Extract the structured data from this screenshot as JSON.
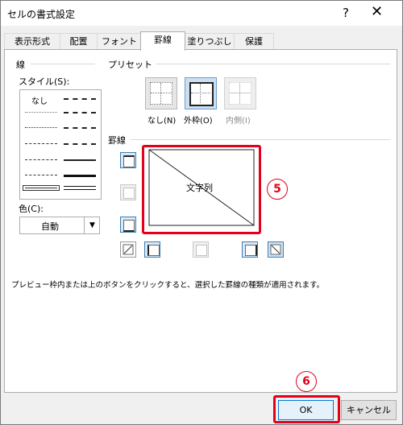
{
  "window": {
    "title": "セルの書式設定",
    "help": "?",
    "close": "✕"
  },
  "tabs": [
    {
      "label": "表示形式"
    },
    {
      "label": "配置"
    },
    {
      "label": "フォント"
    },
    {
      "label": "罫線"
    },
    {
      "label": "塗りつぶし"
    },
    {
      "label": "保護"
    }
  ],
  "line_group": {
    "heading": "線",
    "style_label": "スタイル(S):",
    "none_label": "なし",
    "color_label": "色(C):",
    "color_value": "自動"
  },
  "preset_group": {
    "heading": "プリセット",
    "none": "なし(N)",
    "outline": "外枠(O)",
    "inside": "内側(I)"
  },
  "border_group": {
    "heading": "罫線",
    "preview_text": "文字列"
  },
  "hint": "プレビュー枠内または上のボタンをクリックすると、選択した罫線の種類が適用されます。",
  "callouts": {
    "five": "5",
    "six": "6"
  },
  "buttons": {
    "ok": "OK",
    "cancel": "キャンセル"
  },
  "colors": {
    "accent": "#0078d7",
    "callout": "#e3001b"
  }
}
